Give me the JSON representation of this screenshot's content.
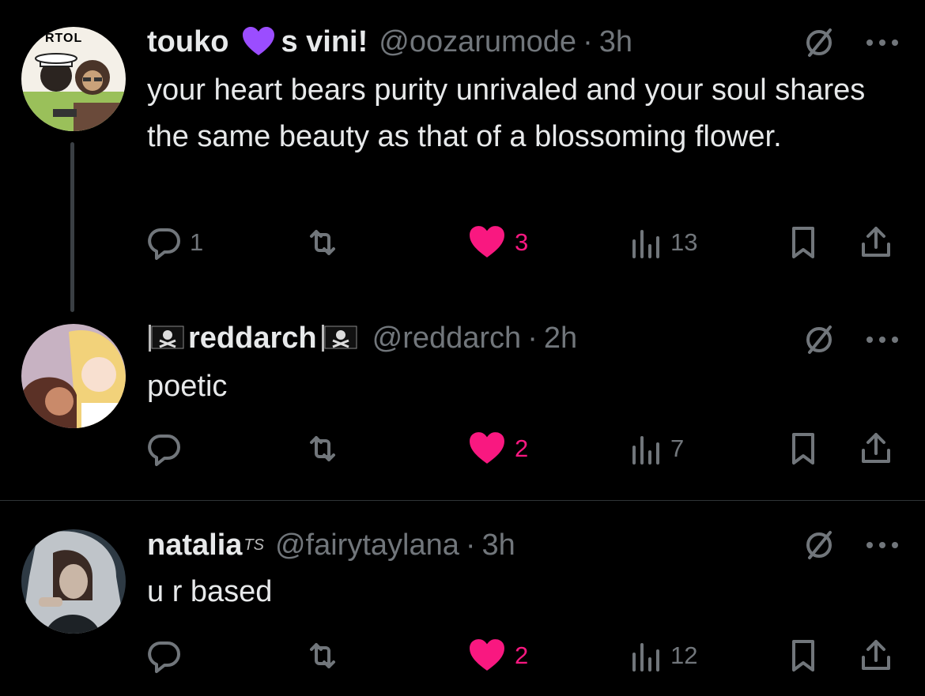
{
  "tweets": [
    {
      "display_name_part1": "touko",
      "display_name_part2": "s vini!",
      "handle": "@oozarumode",
      "separator": "·",
      "time": "3h",
      "text": "your heart bears purity unrivaled and your soul shares the same beauty as that of a blossoming flower.",
      "reply_count": "1",
      "retweet_count": "",
      "like_count": "3",
      "view_count": "13",
      "avatar_text": "RTOL"
    },
    {
      "display_name": "reddarch",
      "handle": "@reddarch",
      "separator": "·",
      "time": "2h",
      "text": "poetic",
      "reply_count": "",
      "retweet_count": "",
      "like_count": "2",
      "view_count": "7"
    },
    {
      "display_name": "natalia",
      "name_suffix": "TS",
      "handle": "@fairytaylana",
      "separator": "·",
      "time": "3h",
      "text": "u r based",
      "reply_count": "",
      "retweet_count": "",
      "like_count": "2",
      "view_count": "12"
    }
  ],
  "colors": {
    "background": "#000000",
    "text": "#e7e9ea",
    "muted": "#71767b",
    "like": "#f91880",
    "purple_heart": "#9b4dff"
  },
  "icons": [
    "reply-icon",
    "retweet-icon",
    "heart-icon",
    "views-icon",
    "bookmark-icon",
    "share-icon",
    "grok-icon",
    "more-icon"
  ]
}
